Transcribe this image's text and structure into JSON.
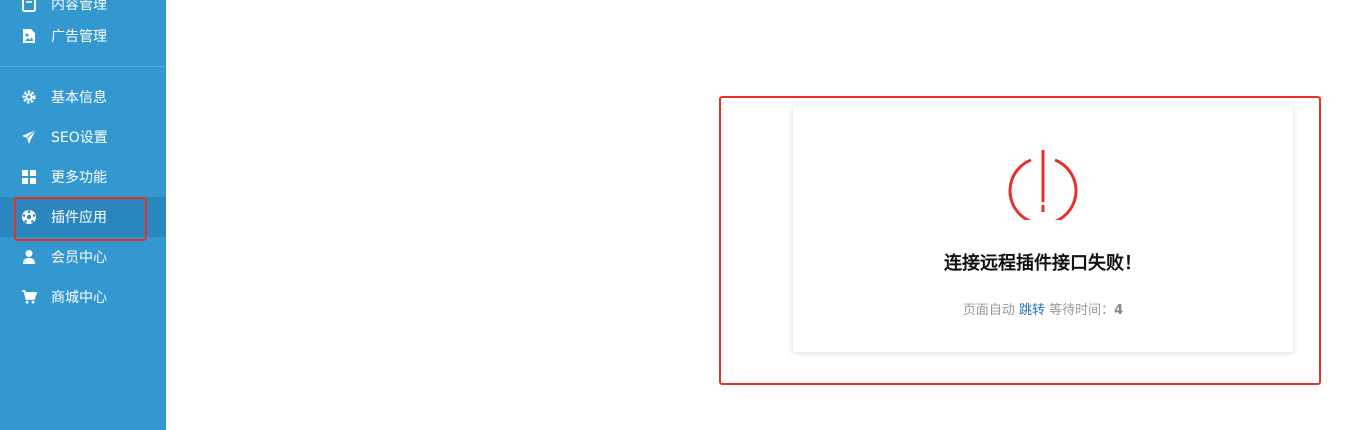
{
  "colors": {
    "sidebar_bg": "#3498d0",
    "sidebar_active": "#2a87bd",
    "highlight": "#e8302a",
    "alert": "#e8302a",
    "link": "#2a6fb0"
  },
  "sidebar": {
    "items": [
      {
        "label": "内容管理",
        "icon": "document-icon"
      },
      {
        "label": "广告管理",
        "icon": "image-file-icon"
      },
      {
        "label": "基本信息",
        "icon": "gear-icon"
      },
      {
        "label": "SEO设置",
        "icon": "paper-plane-icon"
      },
      {
        "label": "更多功能",
        "icon": "grid-icon"
      },
      {
        "label": "插件应用",
        "icon": "soccer-ball-icon",
        "active": true
      },
      {
        "label": "会员中心",
        "icon": "user-icon"
      },
      {
        "label": "商城中心",
        "icon": "cart-icon"
      }
    ]
  },
  "message": {
    "title": "连接远程插件接口失败！",
    "redirect_prefix": "页面自动",
    "redirect_link": "跳转",
    "wait_label": "等待时间：",
    "countdown": "4"
  }
}
